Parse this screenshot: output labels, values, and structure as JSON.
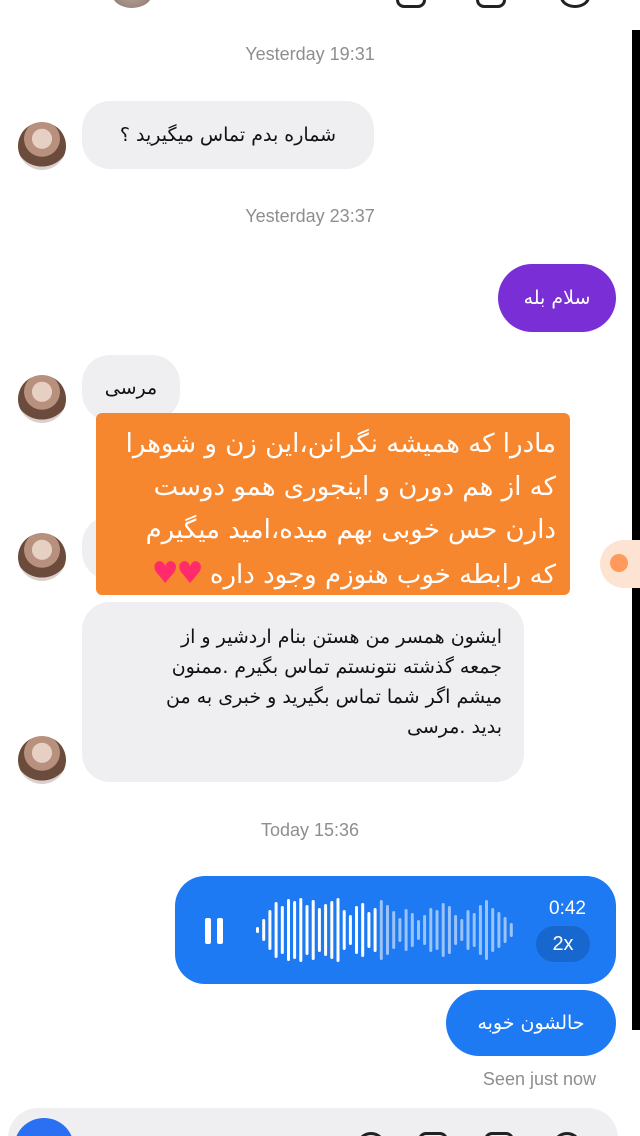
{
  "timestamps": {
    "t1": "Yesterday 19:31",
    "t2": "Yesterday 23:37",
    "t3": "Today 15:36"
  },
  "messages": [
    {
      "from": "them",
      "text": "شماره بدم تماس میگیرید ؟"
    },
    {
      "from": "me",
      "text": "سلام بله"
    },
    {
      "from": "them",
      "text": "مرسی"
    },
    {
      "from": "them",
      "lines": [
        "ایشون همسر من هستن بنام اردشیر و از",
        "جمعه گذشته نتونستم تماس بگیرم .ممنون",
        "میشم اگر شما تماس بگیرید و خبری به من",
        "بدید .مرسی"
      ]
    },
    {
      "from": "me",
      "type": "voice",
      "duration": "0:42",
      "speed": "2x"
    },
    {
      "from": "me",
      "text": "حالشون خوبه"
    }
  ],
  "overlay": {
    "lines": [
      "مادرا که همیشه نگرانن،این زن و شوهرا",
      "که از هم دورن و اینجوری همو دوست",
      "دارن حس خوبی بهم میده،امید میگیرم",
      "که رابطه خوب هنوزم وجود داره"
    ],
    "hearts": "♥♥"
  },
  "status": {
    "seen": "Seen just now"
  },
  "colors": {
    "purple": "#7a2fd6",
    "blue": "#1d7af2",
    "incoming": "#efeff1",
    "overlay": "#f7872e"
  }
}
